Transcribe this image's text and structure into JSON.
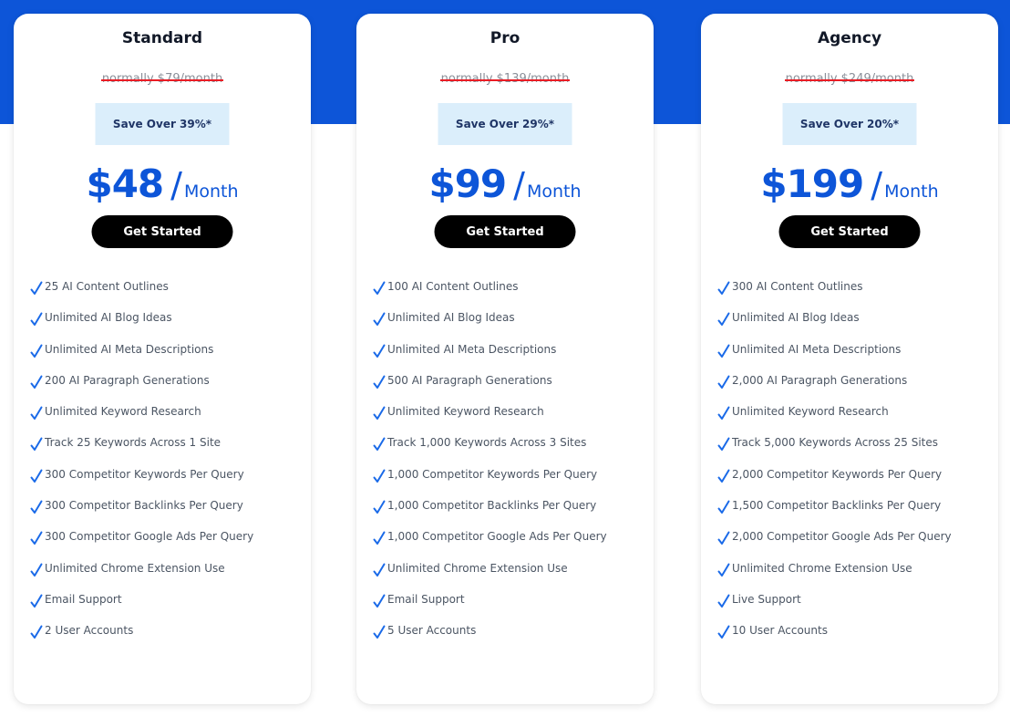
{
  "colors": {
    "accent": "#0d55d8",
    "strike": "#ea1c24",
    "save_bg": "#dbeefb",
    "button_bg": "#000000"
  },
  "plans": [
    {
      "name": "Standard",
      "normally": "normally $79/month",
      "save": "Save Over 39%*",
      "price": "$48",
      "slash": "/",
      "period": "Month",
      "cta": "Get Started",
      "features": [
        "25 AI Content Outlines",
        "Unlimited AI Blog Ideas",
        "Unlimited AI Meta Descriptions",
        "200 AI Paragraph Generations",
        "Unlimited Keyword Research",
        "Track 25 Keywords Across 1 Site",
        "300 Competitor Keywords Per Query",
        "300 Competitor Backlinks Per Query",
        "300 Competitor Google Ads Per Query",
        "Unlimited Chrome Extension Use",
        "Email Support",
        "2 User Accounts"
      ]
    },
    {
      "name": "Pro",
      "normally": "normally $139/month",
      "save": "Save Over 29%*",
      "price": "$99",
      "slash": "/",
      "period": "Month",
      "cta": "Get Started",
      "features": [
        "100 AI Content Outlines",
        "Unlimited AI Blog Ideas",
        "Unlimited AI Meta Descriptions",
        "500 AI Paragraph Generations",
        "Unlimited Keyword Research",
        "Track 1,000 Keywords Across 3 Sites",
        "1,000 Competitor Keywords Per Query",
        "1,000 Competitor Backlinks Per Query",
        "1,000 Competitor Google Ads Per Query",
        "Unlimited Chrome Extension Use",
        "Email Support",
        "5 User Accounts"
      ]
    },
    {
      "name": "Agency",
      "normally": "normally $249/month",
      "save": "Save Over 20%*",
      "price": "$199",
      "slash": "/",
      "period": "Month",
      "cta": "Get Started",
      "features": [
        "300 AI Content Outlines",
        "Unlimited AI Blog Ideas",
        "Unlimited AI Meta Descriptions",
        "2,000 AI Paragraph Generations",
        "Unlimited Keyword Research",
        "Track 5,000 Keywords Across 25 Sites",
        "2,000 Competitor Keywords Per Query",
        "1,500 Competitor Backlinks Per Query",
        "2,000 Competitor Google Ads Per Query",
        "Unlimited Chrome Extension Use",
        "Live Support",
        "10 User Accounts"
      ]
    }
  ]
}
